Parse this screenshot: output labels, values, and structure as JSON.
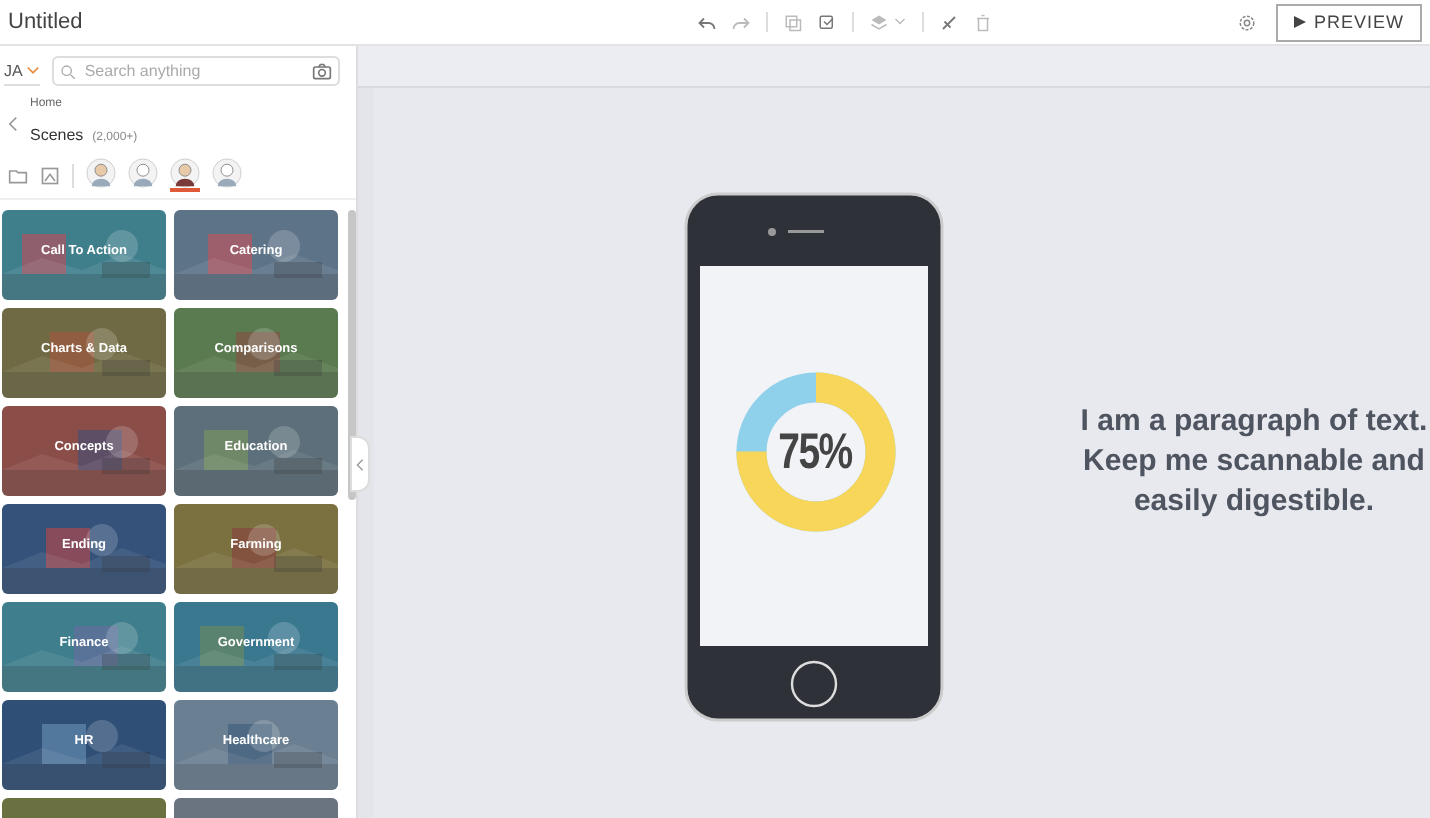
{
  "window": {
    "title": "Untitled"
  },
  "toolbar": {
    "preview": "PREVIEW"
  },
  "sidebar": {
    "language": "JA",
    "search": {
      "placeholder": "Search anything"
    },
    "breadcrumb": "Home",
    "heading": "Scenes",
    "count": "(2,000+)",
    "characters": [
      {
        "selected": false
      },
      {
        "selected": false
      },
      {
        "selected": true
      },
      {
        "selected": false
      }
    ],
    "tiles": [
      {
        "label": "Call To Action"
      },
      {
        "label": "Catering"
      },
      {
        "label": "Charts & Data"
      },
      {
        "label": "Comparisons"
      },
      {
        "label": "Concepts"
      },
      {
        "label": "Education"
      },
      {
        "label": "Ending"
      },
      {
        "label": "Farming"
      },
      {
        "label": "Finance"
      },
      {
        "label": "Government"
      },
      {
        "label": "HR"
      },
      {
        "label": "Healthcare"
      },
      {
        "kind": "picture"
      },
      {
        "kind": "picture"
      }
    ]
  },
  "slide": {
    "donut": {
      "level": 0.75,
      "label": "75%"
    },
    "paragraph": "I am a paragraph of text. Keep me scannable and easily digestible."
  }
}
